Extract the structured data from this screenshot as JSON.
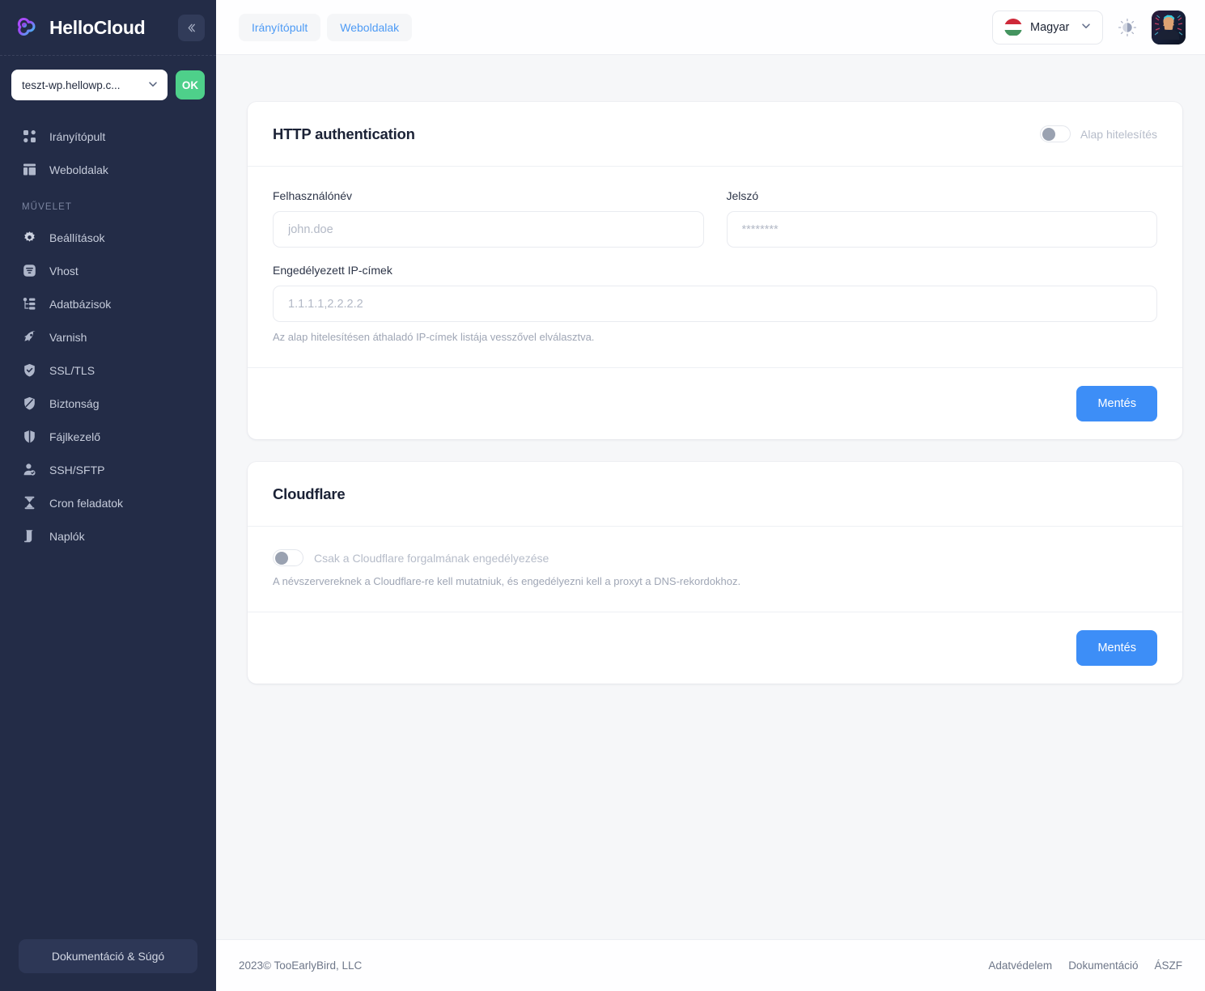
{
  "brand": {
    "name": "HelloCloud",
    "logo_icon": "cloud-logo-icon",
    "collapse_icon": "chevron-double-left-icon"
  },
  "sidebar": {
    "site_selector": {
      "value": "teszt-wp.hellowp.c...",
      "chevron_icon": "chevron-down-icon"
    },
    "ok_button": "OK",
    "primary_items": [
      {
        "label": "Irányítópult",
        "icon": "dashboard-grid-icon"
      },
      {
        "label": "Weboldalak",
        "icon": "layout-panels-icon"
      }
    ],
    "section_label": "MŰVELET",
    "action_items": [
      {
        "label": "Beállítások",
        "icon": "gear-icon"
      },
      {
        "label": "Vhost",
        "icon": "filter-server-icon"
      },
      {
        "label": "Adatbázisok",
        "icon": "database-tree-icon"
      },
      {
        "label": "Varnish",
        "icon": "rocket-icon"
      },
      {
        "label": "SSL/TLS",
        "icon": "shield-check-icon"
      },
      {
        "label": "Biztonság",
        "icon": "shield-icon"
      },
      {
        "label": "Fájlkezelő",
        "icon": "folder-icon"
      },
      {
        "label": "SSH/SFTP",
        "icon": "user-key-icon"
      },
      {
        "label": "Cron feladatok",
        "icon": "hourglass-icon"
      },
      {
        "label": "Naplók",
        "icon": "logs-icon"
      }
    ],
    "docs_button": "Dokumentáció & Súgó"
  },
  "topbar": {
    "breadcrumbs": [
      {
        "label": "Irányítópult"
      },
      {
        "label": "Weboldalak"
      }
    ],
    "language": {
      "label": "Magyar",
      "flag_icon": "hungary-flag-icon",
      "chevron_icon": "chevron-down-icon"
    },
    "theme_toggle_icon": "sun-moon-icon",
    "avatar_icon": "user-avatar"
  },
  "http_auth_card": {
    "title": "HTTP authentication",
    "toggle_label": "Alap hitelesítés",
    "toggle_on": false,
    "username": {
      "label": "Felhasználónév",
      "placeholder": "john.doe",
      "value": ""
    },
    "password": {
      "label": "Jelszó",
      "placeholder": "********",
      "value": ""
    },
    "allowed_ips": {
      "label": "Engedélyezett IP-címek",
      "placeholder": "1.1.1.1,2.2.2.2",
      "value": "",
      "hint": "Az alap hitelesítésen áthaladó IP-címek listája vesszővel elválasztva."
    },
    "save_button": "Mentés"
  },
  "cloudflare_card": {
    "title": "Cloudflare",
    "toggle_label": "Csak a Cloudflare forgalmának engedélyezése",
    "toggle_on": false,
    "hint": "A névszervereknek a Cloudflare-re kell mutatniuk, és engedélyezni kell a proxyt a DNS-rekordokhoz.",
    "save_button": "Mentés"
  },
  "footer": {
    "copyright": "2023© TooEarlyBird, LLC",
    "links": [
      {
        "label": "Adatvédelem"
      },
      {
        "label": "Dokumentáció"
      },
      {
        "label": "ÁSZF"
      }
    ]
  },
  "colors": {
    "sidebar_bg": "#232c47",
    "accent_blue": "#3d8ef7",
    "ok_green": "#4ed08a",
    "link_blue": "#4e9bf5",
    "page_bg": "#f6f7f9"
  }
}
